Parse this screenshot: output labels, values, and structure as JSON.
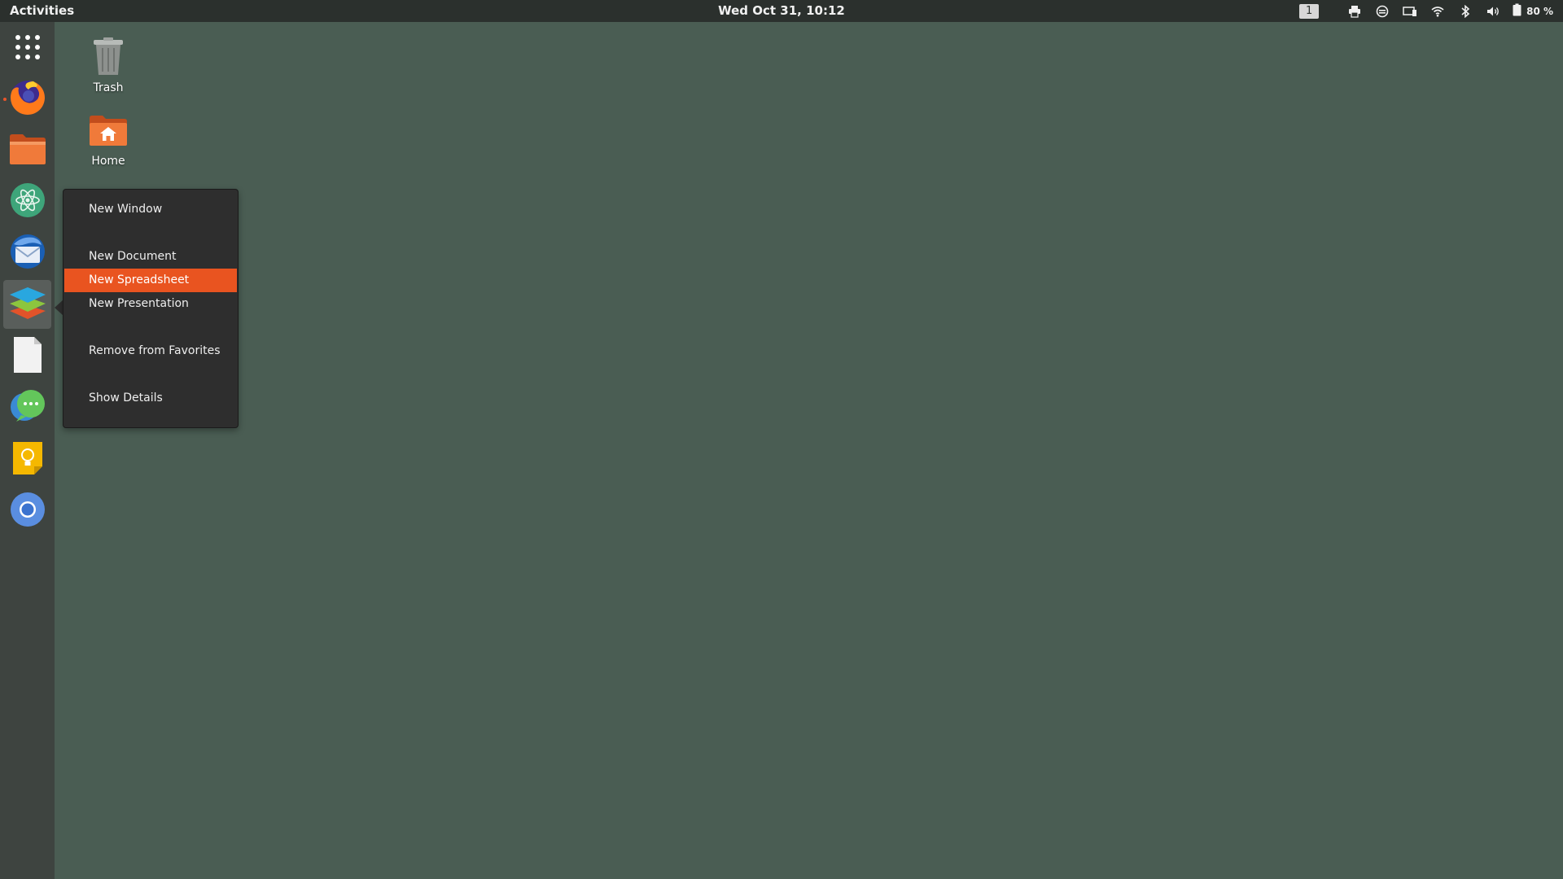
{
  "topbar": {
    "activities": "Activities",
    "clock": "Wed Oct 31, 10:12",
    "workspace": "1",
    "battery": "80 %"
  },
  "dock": {
    "items": [
      {
        "icon": "app-grid-icon"
      },
      {
        "icon": "firefox-icon",
        "running": true
      },
      {
        "icon": "files-icon"
      },
      {
        "icon": "atom-icon"
      },
      {
        "icon": "thunderbird-icon"
      },
      {
        "icon": "onlyoffice-icon",
        "active": true
      },
      {
        "icon": "document-viewer-icon"
      },
      {
        "icon": "chat-icon"
      },
      {
        "icon": "keep-notes-icon"
      },
      {
        "icon": "chromium-icon"
      }
    ]
  },
  "desktop": {
    "icons": [
      {
        "label": "Trash",
        "icon": "trash-icon"
      },
      {
        "label": "Home",
        "icon": "home-folder-icon"
      }
    ]
  },
  "context_menu": {
    "items": [
      {
        "label": "New Window"
      },
      {
        "label": "New Document"
      },
      {
        "label": "New Spreadsheet",
        "highlighted": true
      },
      {
        "label": "New Presentation"
      },
      {
        "label": "Remove from Favorites"
      },
      {
        "label": "Show Details"
      }
    ]
  },
  "colors": {
    "desktop_bg": "#4a5d53",
    "topbar_bg": "#2b302d",
    "dock_bg": "#3e4440",
    "menu_bg": "#2e2e2e",
    "accent": "#e95420"
  }
}
